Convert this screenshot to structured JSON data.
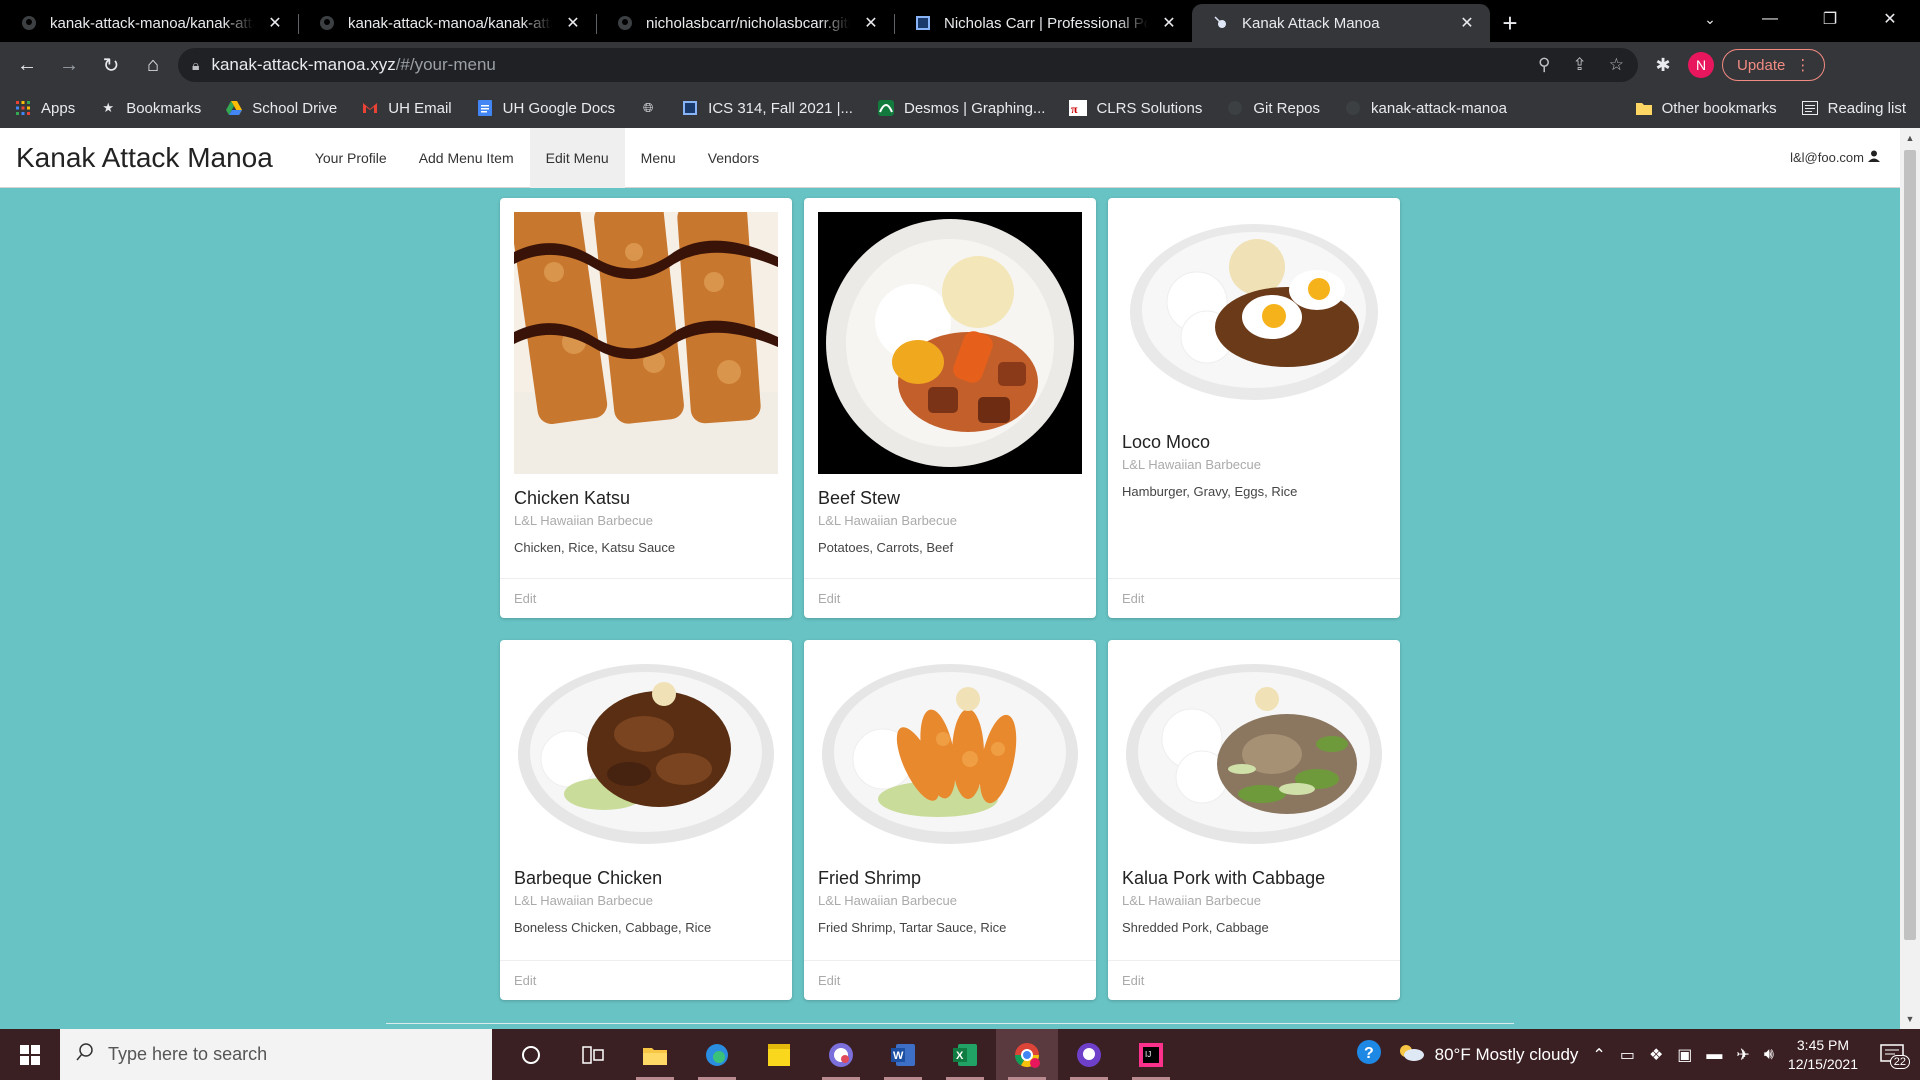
{
  "browser": {
    "tabs": [
      {
        "title": "kanak-attack-manoa/kanak-attack-manoa",
        "icon": "github-icon",
        "active": false
      },
      {
        "title": "kanak-attack-manoa/kanak-attack-manoa",
        "icon": "github-icon",
        "active": false
      },
      {
        "title": "nicholasbcarr/nicholasbcarr.github.io",
        "icon": "github-icon",
        "active": false
      },
      {
        "title": "Nicholas Carr | Professional Portfolio",
        "icon": "page-icon",
        "active": false
      },
      {
        "title": "Kanak Attack Manoa",
        "icon": "meteor-icon",
        "active": true
      }
    ],
    "url_host": "kanak-attack-manoa.xyz",
    "url_path": "/#/your-menu",
    "profile_initial": "N",
    "update_label": "Update",
    "bookmarks": [
      {
        "label": "Apps",
        "icon": "apps-grid-icon"
      },
      {
        "label": "Bookmarks",
        "icon": "star-icon"
      },
      {
        "label": "School Drive",
        "icon": "drive-icon"
      },
      {
        "label": "UH Email",
        "icon": "gmail-icon"
      },
      {
        "label": "UH Google Docs",
        "icon": "docs-icon"
      },
      {
        "label": "",
        "icon": "globe-icon"
      },
      {
        "label": "ICS 314, Fall 2021 |...",
        "icon": "page-icon"
      },
      {
        "label": "Desmos | Graphing...",
        "icon": "desmos-icon"
      },
      {
        "label": "CLRS Solutions",
        "icon": "clrs-icon"
      },
      {
        "label": "Git Repos",
        "icon": "github-icon"
      },
      {
        "label": "kanak-attack-manoa",
        "icon": "github-icon"
      }
    ],
    "other_bookmarks": "Other bookmarks",
    "reading_list": "Reading list"
  },
  "site": {
    "brand": "Kanak Attack Manoa",
    "nav": [
      {
        "label": "Your Profile",
        "active": false
      },
      {
        "label": "Add Menu Item",
        "active": false
      },
      {
        "label": "Edit Menu",
        "active": true
      },
      {
        "label": "Menu",
        "active": false
      },
      {
        "label": "Vendors",
        "active": false
      }
    ],
    "user": "l&l@foo.com"
  },
  "menu_items": [
    {
      "name": "Chicken Katsu",
      "vendor": "L&L Hawaiian Barbecue",
      "ingredients": "Chicken, Rice, Katsu Sauce",
      "action": "Edit",
      "image": "chicken-katsu"
    },
    {
      "name": "Beef Stew",
      "vendor": "L&L Hawaiian Barbecue",
      "ingredients": "Potatoes, Carrots, Beef",
      "action": "Edit",
      "image": "beef-stew"
    },
    {
      "name": "Loco Moco",
      "vendor": "L&L Hawaiian Barbecue",
      "ingredients": "Hamburger, Gravy, Eggs, Rice",
      "action": "Edit",
      "image": "loco-moco"
    },
    {
      "name": "Barbeque Chicken",
      "vendor": "L&L Hawaiian Barbecue",
      "ingredients": "Boneless Chicken, Cabbage, Rice",
      "action": "Edit",
      "image": "bbq-chicken"
    },
    {
      "name": "Fried Shrimp",
      "vendor": "L&L Hawaiian Barbecue",
      "ingredients": "Fried Shrimp, Tartar Sauce, Rice",
      "action": "Edit",
      "image": "fried-shrimp"
    },
    {
      "name": "Kalua Pork with Cabbage",
      "vendor": "L&L Hawaiian Barbecue",
      "ingredients": "Shredded Pork, Cabbage",
      "action": "Edit",
      "image": "kalua-pork"
    }
  ],
  "taskbar": {
    "search_placeholder": "Type here to search",
    "weather": "80°F  Mostly cloudy",
    "time": "3:45 PM",
    "date": "12/15/2021",
    "notifications": "22"
  },
  "colors": {
    "page_bg": "#68c3c4",
    "taskbar_bg": "#3a1f23"
  }
}
